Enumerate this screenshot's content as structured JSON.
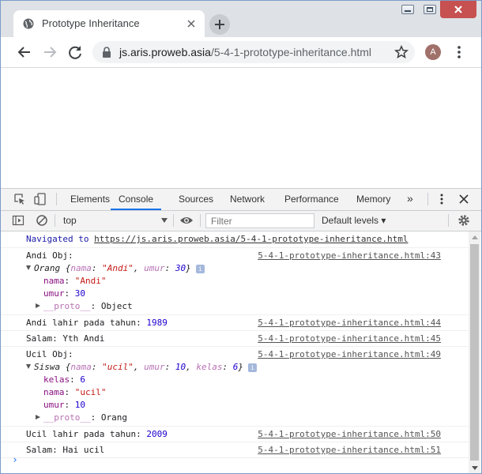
{
  "browser": {
    "tab_title": "Prototype Inheritance",
    "url_host": "js.aris.proweb.asia",
    "url_path": "/5-4-1-prototype-inheritance.html",
    "profile_initial": "A"
  },
  "devtools": {
    "tabs": [
      {
        "label": "Elements",
        "active": false
      },
      {
        "label": "Console",
        "active": true
      },
      {
        "label": "Sources",
        "active": false
      },
      {
        "label": "Network",
        "active": false
      },
      {
        "label": "Performance",
        "active": false
      },
      {
        "label": "Memory",
        "active": false
      }
    ],
    "more_tabs": "»",
    "context": "top",
    "filter_placeholder": "Filter",
    "levels": "Default levels ▾"
  },
  "console": {
    "navigated_prefix": "Navigated to ",
    "navigated_url": "https://js.aris.proweb.asia/5-4-1-prototype-inheritance.html",
    "andi_label": "Andi Obj:",
    "andi_src": "5-4-1-prototype-inheritance.html:43",
    "andi_class": "Orang",
    "andi_summary_nama": "\"Andi\"",
    "andi_summary_umur": "30",
    "andi_nama": "\"Andi\"",
    "andi_umur": "30",
    "andi_proto": "Object",
    "lahir_andi": "Andi lahir pada tahun: ",
    "lahir_andi_val": "1989",
    "lahir_andi_src": "5-4-1-prototype-inheritance.html:44",
    "salam_andi": "Salam: Yth Andi",
    "salam_andi_src": "5-4-1-prototype-inheritance.html:45",
    "ucil_label": "Ucil Obj:",
    "ucil_src": "5-4-1-prototype-inheritance.html:49",
    "ucil_class": "Siswa",
    "ucil_summary_nama": "\"ucil\"",
    "ucil_summary_umur": "10",
    "ucil_summary_kelas": "6",
    "ucil_kelas": "6",
    "ucil_nama": "\"ucil\"",
    "ucil_umur": "10",
    "ucil_proto": "Orang",
    "lahir_ucil": "Ucil lahir pada tahun: ",
    "lahir_ucil_val": "2009",
    "lahir_ucil_src": "5-4-1-prototype-inheritance.html:50",
    "salam_ucil": "Salam: Hai ucil",
    "salam_ucil_src": "5-4-1-prototype-inheritance.html:51",
    "prompt": "›"
  },
  "labels": {
    "nama": "nama",
    "umur": "umur",
    "kelas": "kelas",
    "proto": "__proto__",
    "info": "i"
  }
}
